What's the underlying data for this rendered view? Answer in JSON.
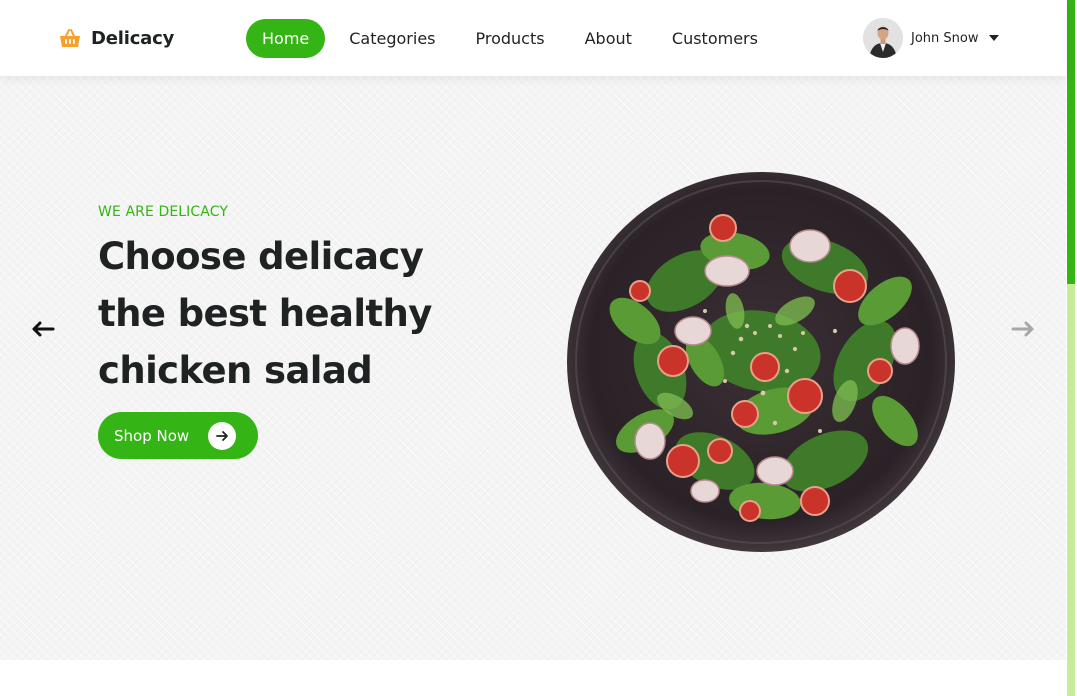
{
  "brand": {
    "name": "Delicacy",
    "icon": "basket-icon",
    "icon_color": "#f5a02a"
  },
  "nav": {
    "items": [
      {
        "label": "Home",
        "active": true
      },
      {
        "label": "Categories",
        "active": false
      },
      {
        "label": "Products",
        "active": false
      },
      {
        "label": "About",
        "active": false
      },
      {
        "label": "Customers",
        "active": false
      }
    ]
  },
  "user": {
    "name": "John Snow",
    "icon": "chevron-down-icon"
  },
  "hero": {
    "tagline": "WE ARE DELICACY",
    "headline": "Choose delicacy the best healthy chicken salad",
    "cta_label": "Shop Now",
    "prev_icon": "arrow-left-icon",
    "next_icon": "arrow-right-icon"
  },
  "scrollbar": {
    "position_fraction": 0.0
  },
  "colors": {
    "accent": "#35b415",
    "text": "#1f2222",
    "hero_bg": "#f4f4f4",
    "scroll_track": "#c6ec9a"
  }
}
